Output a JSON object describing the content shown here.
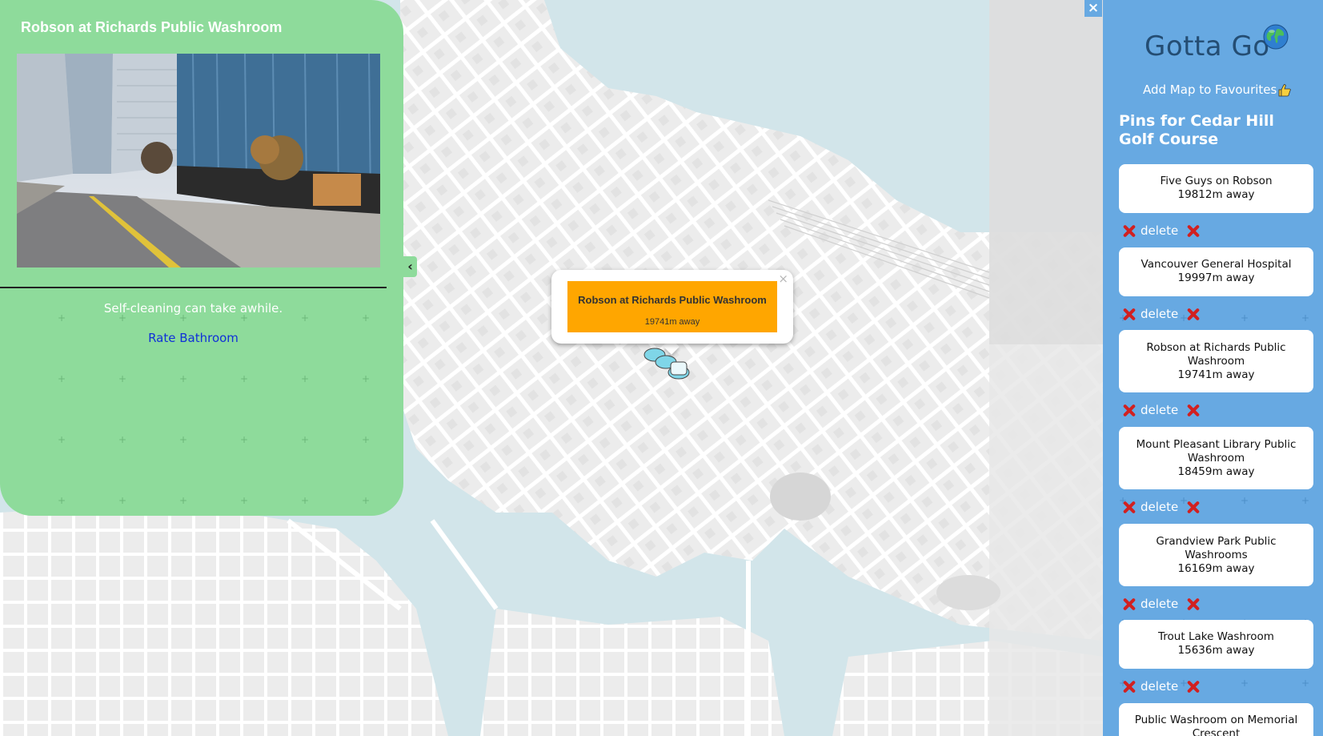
{
  "map": {
    "popup": {
      "title": "Robson at Richards Public Washroom",
      "distance": "19741m away",
      "close_symbol": "×"
    }
  },
  "detail_panel": {
    "title": "Robson at Richards Public Washroom",
    "note": "Self-cleaning can take awhile.",
    "rate_link": "Rate Bathroom",
    "collapse_symbol": "‹"
  },
  "sidebar": {
    "close_symbol": "×",
    "app_title": "Gotta Go",
    "favourites_label": "Add Map to Favourites",
    "pins_heading": "Pins for Cedar Hill Golf Course",
    "delete_label": "delete",
    "pins": [
      {
        "name": "Five Guys on Robson",
        "distance": "19812m away"
      },
      {
        "name": "Vancouver General Hospital",
        "distance": "19997m away"
      },
      {
        "name": "Robson at Richards Public Washroom",
        "distance": "19741m away"
      },
      {
        "name": "Mount Pleasant Library Public Washroom",
        "distance": "18459m away"
      },
      {
        "name": "Grandview Park Public Washrooms",
        "distance": "16169m away"
      },
      {
        "name": "Trout Lake Washroom",
        "distance": "15636m away"
      },
      {
        "name": "Public Washroom on Memorial Crescent",
        "distance": ""
      }
    ]
  },
  "colors": {
    "detail_panel_bg": "#8edb9b",
    "sidebar_bg": "#67a9e2",
    "popup_accent": "#ffa600",
    "link": "#1030d8",
    "delete_x": "#d12020"
  }
}
